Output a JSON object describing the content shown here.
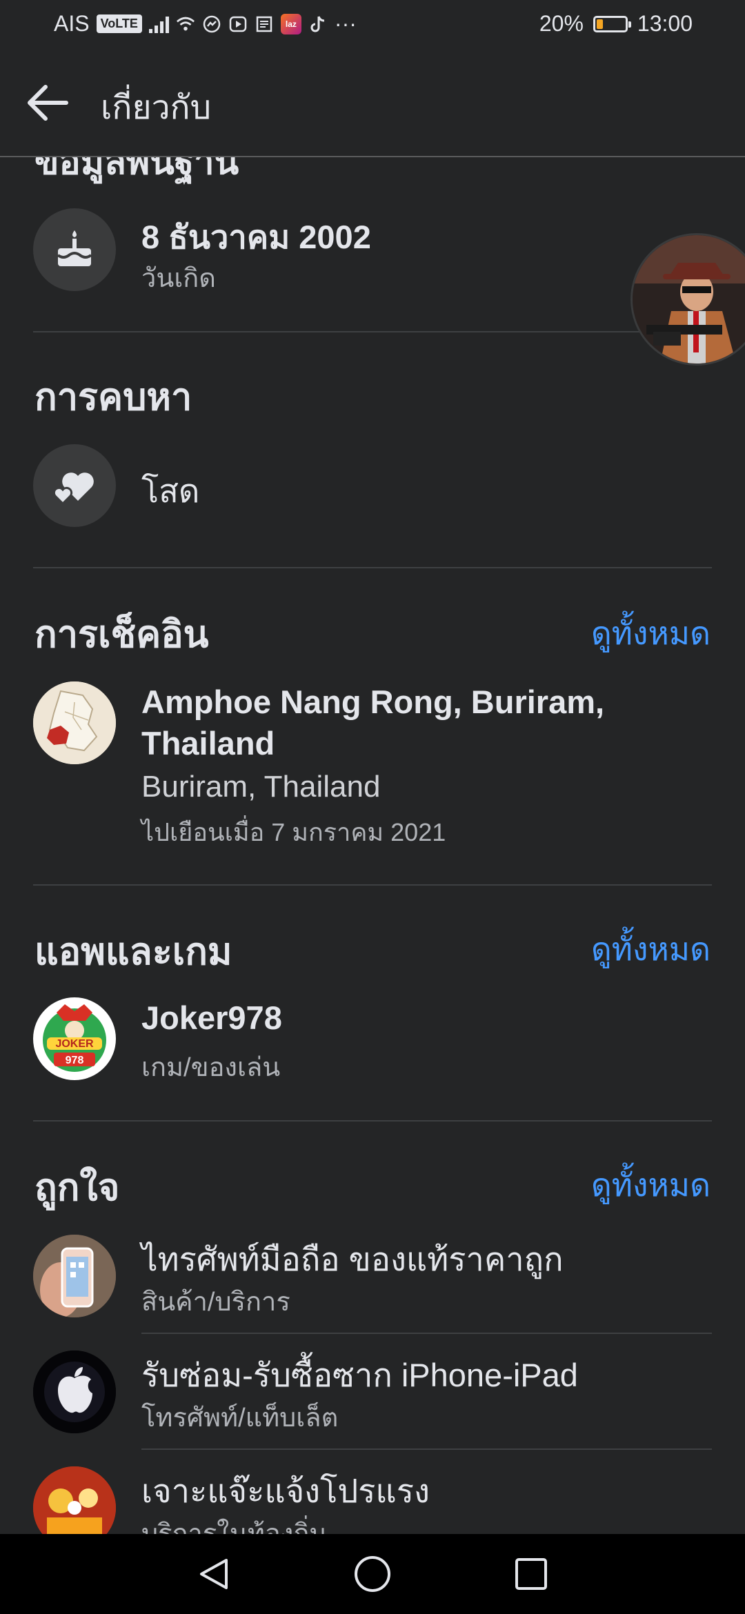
{
  "status_bar": {
    "carrier": "AIS",
    "volte": "VoLTE",
    "battery_percent": "20%",
    "time": "13:00",
    "battery_level": 0.2,
    "icons": [
      "signal-icon",
      "wifi-icon",
      "messenger-icon",
      "play-icon",
      "news-icon",
      "lazada-icon",
      "tiktok-icon",
      "more-icon"
    ],
    "lazada_label": "laz",
    "more_label": "···"
  },
  "header": {
    "title": "เกี่ยวกับ"
  },
  "cut_heading": "ข้อมูลพื้นฐาน",
  "birthday": {
    "value": "8 ธันวาคม  2002",
    "label": "วันเกิด"
  },
  "relationship": {
    "title": "การคบหา",
    "value": "โสด"
  },
  "checkins": {
    "title": "การเช็คอิน",
    "see_all": "ดูทั้งหมด",
    "place_line1": "Amphoe Nang Rong, Buriram,",
    "place_line2": "Thailand",
    "region": "Buriram, Thailand",
    "visited": "ไปเยือนเมื่อ 7 มกราคม  2021"
  },
  "apps": {
    "title": "แอพและเกม",
    "see_all": "ดูทั้งหมด",
    "items": [
      {
        "name": "Joker978",
        "category": "เกม/ของเล่น",
        "logo_text": "JOKER",
        "logo_number": "978"
      }
    ]
  },
  "likes": {
    "title": "ถูกใจ",
    "see_all": "ดูทั้งหมด",
    "items": [
      {
        "name": "ไทรศัพท์มือถือ ของแท้ราคาถูก",
        "category": "สินค้า/บริการ"
      },
      {
        "name": "รับซ่อม-รับซื้อซาก iPhone-iPad",
        "category": "โทรศัพท์/แท็บเล็ต"
      },
      {
        "name": "เจาะแจ๊ะแจ้งโปรแรง",
        "category": "บริการในท้องถิ่น"
      }
    ]
  },
  "colors": {
    "background": "#242526",
    "link": "#4599ff",
    "text": "#e4e6eb",
    "muted": "#b0b3b8"
  }
}
